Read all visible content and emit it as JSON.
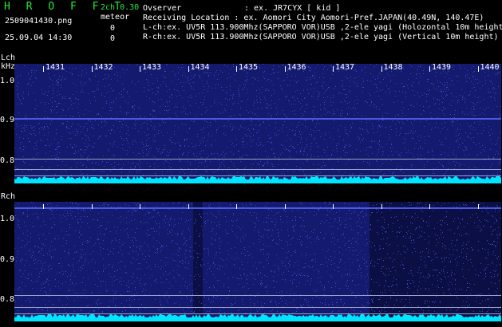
{
  "header": {
    "app_title": "H R O F F T",
    "mode": "2ch 0.30",
    "category": "meteor",
    "count_left": "0",
    "count_right": "0",
    "filename": "2509041430.png",
    "datetime": "25.09.04 14:30",
    "observer_label": "Ovserver",
    "observer_value": ": ex. JR7CYX [ kid ]",
    "location": "Receiving Location : ex. Aomori City Aomori-Pref.JAPAN(40.49N, 140.47E)",
    "lch_desc": "L-ch:ex. UV5R 113.900Mhz(SAPPORO VOR)USB ,2-ele yagi (Holozontal 10m height",
    "rch_desc": "R-ch:ex. UV5R 113.900Mhz(SAPPORO VOR)USB ,2-ele yagi (Vertical 10m height)"
  },
  "lch": {
    "label": "Lch",
    "unit": "kHz",
    "ticks": [
      "1.0",
      "0.9",
      "0.8"
    ]
  },
  "rch": {
    "label": "Rch",
    "ticks": [
      "1.0",
      "0.9",
      "0.8"
    ]
  },
  "minutes": [
    "1431",
    "1432",
    "1433",
    "1434",
    "1435",
    "1436",
    "1437",
    "1438",
    "1439",
    "1440"
  ],
  "colors": {
    "background": "#000000",
    "waterfall": "#141a6e",
    "noise": "#3c48c8",
    "signal": "#00e5ff",
    "title_green": "#27e63a"
  }
}
